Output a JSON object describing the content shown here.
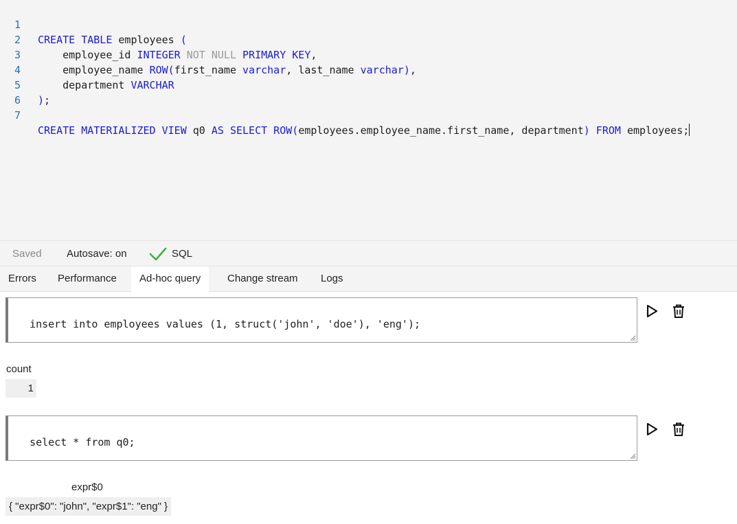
{
  "editor": {
    "lines": [
      {
        "num": "1"
      },
      {
        "num": "2"
      },
      {
        "num": "3"
      },
      {
        "num": "4"
      },
      {
        "num": "5"
      },
      {
        "num": "6"
      },
      {
        "num": "7"
      }
    ],
    "tokens": {
      "l1_a": "CREATE",
      "l1_b": "TABLE",
      "l1_c": " employees ",
      "l1_d": "(",
      "l2_a": "    employee_id ",
      "l2_b": "INTEGER",
      "l2_c": " ",
      "l2_d": "NOT NULL",
      "l2_e": " ",
      "l2_f": "PRIMARY KEY",
      "l2_g": ",",
      "l3_a": "    employee_name ",
      "l3_b": "ROW(",
      "l3_c": "first_name ",
      "l3_d": "varchar",
      "l3_e": ", last_name ",
      "l3_f": "varchar",
      "l3_g": ")",
      "l3_h": ",",
      "l4_a": "    department ",
      "l4_b": "VARCHAR",
      "l5_a": ")",
      "l5_b": ";",
      "l7_a": "CREATE MATERIALIZED VIEW",
      "l7_b": " q0 ",
      "l7_c": "AS SELECT ROW(",
      "l7_d": "employees.employee_name.first_name, department",
      "l7_e": ")",
      "l7_f": " ",
      "l7_g": "FROM",
      "l7_h": " employees;"
    }
  },
  "status": {
    "saved": "Saved",
    "autosave": "Autosave: on",
    "language": "SQL",
    "check_color": "#3db33d"
  },
  "tabs": [
    {
      "label": "Errors"
    },
    {
      "label": "Performance"
    },
    {
      "label": "Ad-hoc query"
    },
    {
      "label": "Change stream"
    },
    {
      "label": "Logs"
    }
  ],
  "queries": [
    {
      "sql": "insert into employees values (1, struct('john', 'doe'), 'eng');",
      "result": {
        "header": "count",
        "cell": "1"
      }
    },
    {
      "sql": "select * from q0;",
      "result": {
        "header": "expr$0",
        "cell": "{ \"expr$0\": \"john\", \"expr$1\": \"eng\" }"
      }
    }
  ]
}
